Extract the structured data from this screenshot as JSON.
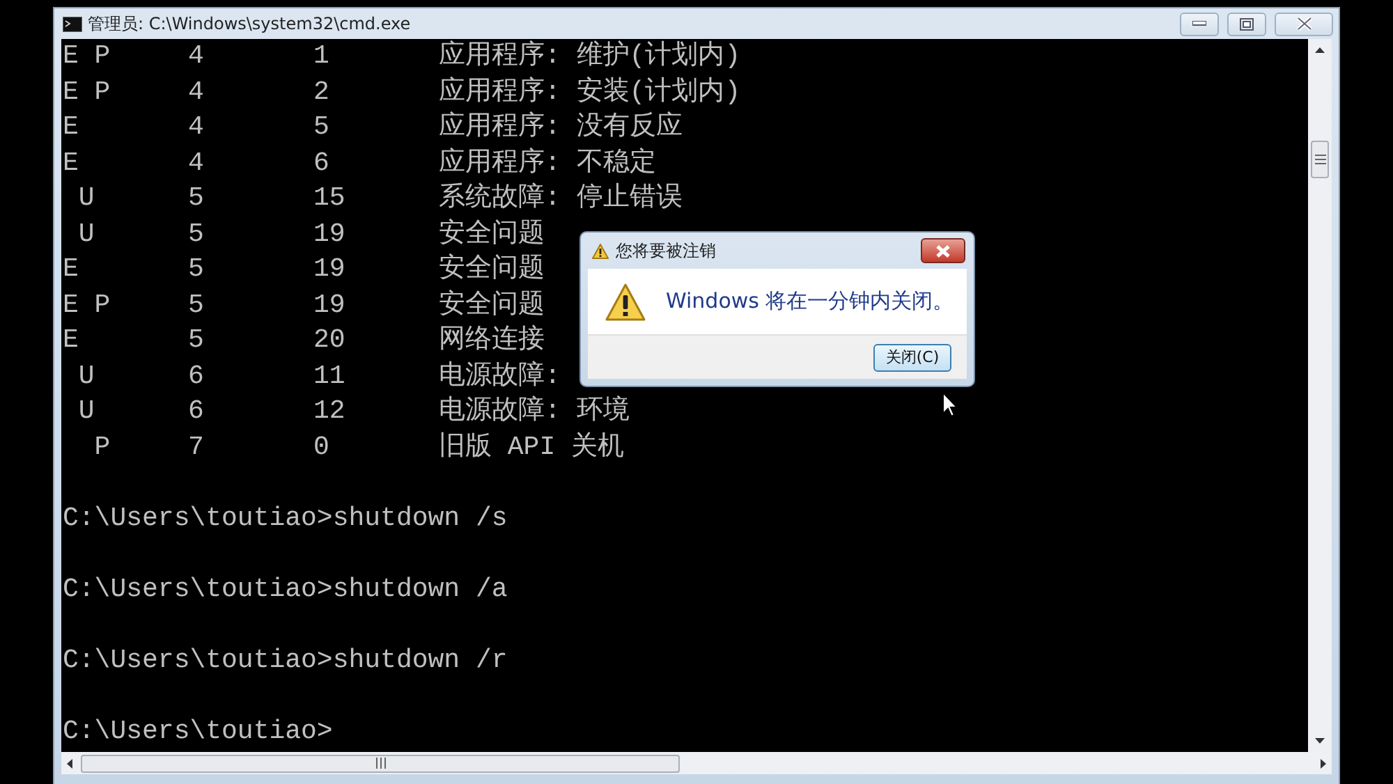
{
  "window": {
    "title": "管理员: C:\\Windows\\system32\\cmd.exe"
  },
  "console": {
    "rows": [
      {
        "flags": "E P",
        "major": "4",
        "minor": "1",
        "reason": "应用程序: 维护(计划内)"
      },
      {
        "flags": "E P",
        "major": "4",
        "minor": "2",
        "reason": "应用程序: 安装(计划内)"
      },
      {
        "flags": "E",
        "major": "4",
        "minor": "5",
        "reason": "应用程序: 没有反应"
      },
      {
        "flags": "E",
        "major": "4",
        "minor": "6",
        "reason": "应用程序: 不稳定"
      },
      {
        "flags": " U",
        "major": "5",
        "minor": "15",
        "reason": "系统故障: 停止错误"
      },
      {
        "flags": " U",
        "major": "5",
        "minor": "19",
        "reason": "安全问题"
      },
      {
        "flags": "E",
        "major": "5",
        "minor": "19",
        "reason": "安全问题"
      },
      {
        "flags": "E P",
        "major": "5",
        "minor": "19",
        "reason": "安全问题"
      },
      {
        "flags": "E",
        "major": "5",
        "minor": "20",
        "reason": "网络连接"
      },
      {
        "flags": " U",
        "major": "6",
        "minor": "11",
        "reason": "电源故障:"
      },
      {
        "flags": " U",
        "major": "6",
        "minor": "12",
        "reason": "电源故障: 环境"
      },
      {
        "flags": "  P",
        "major": "7",
        "minor": "0",
        "reason": "旧版 API 关机"
      }
    ],
    "prompts": [
      "C:\\Users\\toutiao>shutdown /s",
      "C:\\Users\\toutiao>shutdown /a",
      "C:\\Users\\toutiao>shutdown /r",
      "C:\\Users\\toutiao>"
    ]
  },
  "dialog": {
    "title": "您将要被注销",
    "message": "Windows 将在一分钟内关闭。",
    "button": "关闭(C)"
  }
}
